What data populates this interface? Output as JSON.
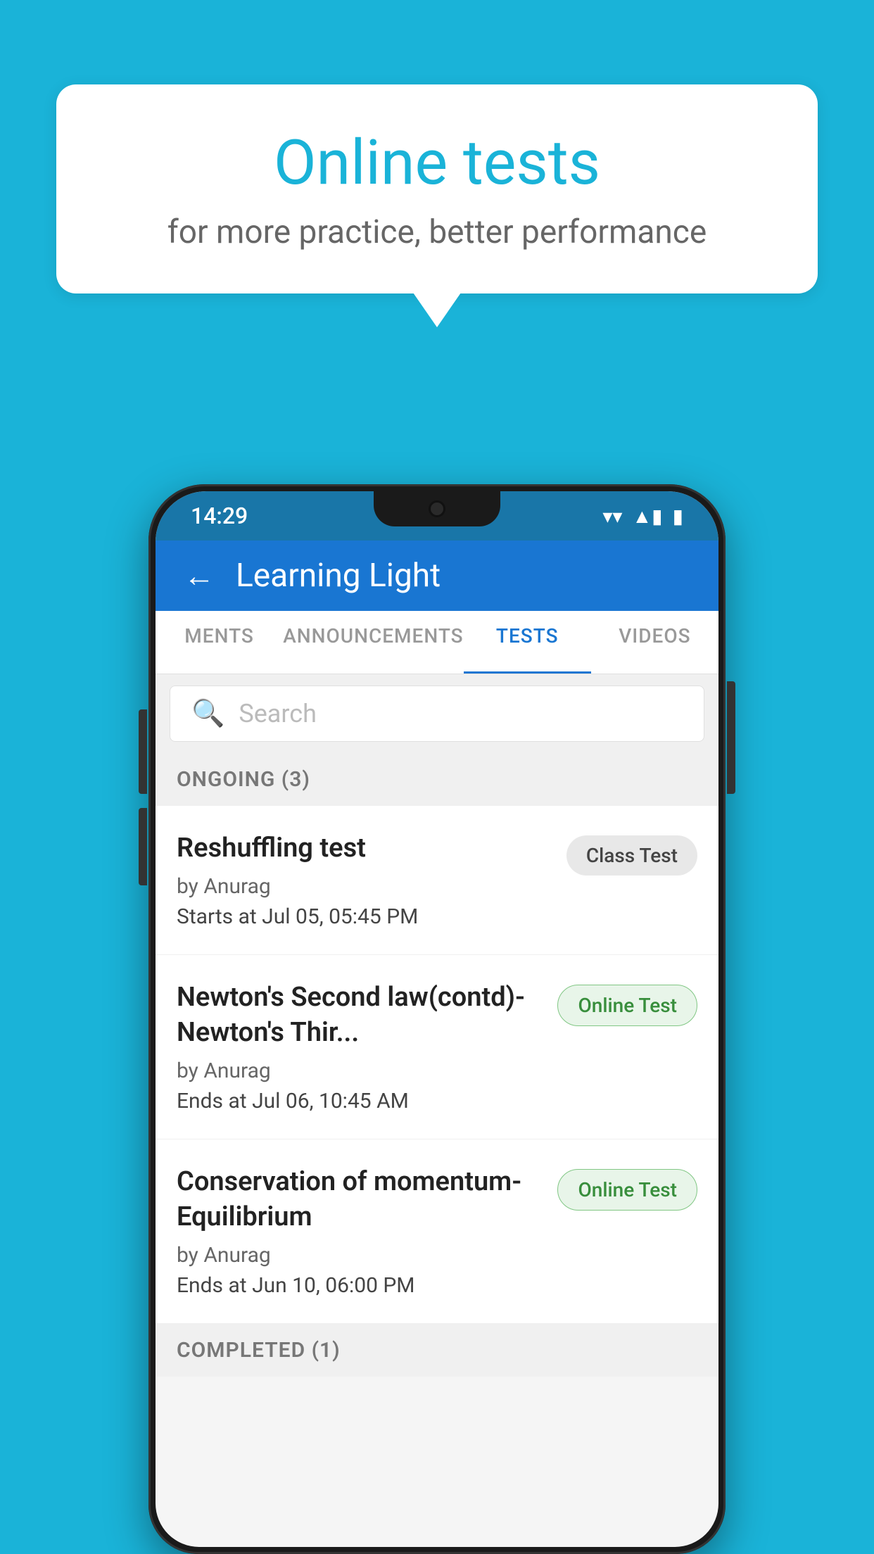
{
  "background": {
    "color": "#1ab3d8"
  },
  "speech_bubble": {
    "title": "Online tests",
    "subtitle": "for more practice, better performance"
  },
  "phone": {
    "status_bar": {
      "time": "14:29",
      "wifi": "▾",
      "signal": "▲",
      "battery": "▮"
    },
    "header": {
      "back_label": "←",
      "title": "Learning Light"
    },
    "tabs": [
      {
        "label": "MENTS",
        "active": false
      },
      {
        "label": "ANNOUNCEMENTS",
        "active": false
      },
      {
        "label": "TESTS",
        "active": true
      },
      {
        "label": "VIDEOS",
        "active": false
      }
    ],
    "search": {
      "placeholder": "Search"
    },
    "ongoing_section": {
      "label": "ONGOING (3)"
    },
    "tests": [
      {
        "name": "Reshuffling test",
        "author": "by Anurag",
        "time_label": "Starts at",
        "time": "Jul 05, 05:45 PM",
        "badge": "Class Test",
        "badge_type": "class"
      },
      {
        "name": "Newton's Second law(contd)-Newton's Thir...",
        "author": "by Anurag",
        "time_label": "Ends at",
        "time": "Jul 06, 10:45 AM",
        "badge": "Online Test",
        "badge_type": "online"
      },
      {
        "name": "Conservation of momentum-Equilibrium",
        "author": "by Anurag",
        "time_label": "Ends at",
        "time": "Jun 10, 06:00 PM",
        "badge": "Online Test",
        "badge_type": "online"
      }
    ],
    "completed_section": {
      "label": "COMPLETED (1)"
    }
  }
}
